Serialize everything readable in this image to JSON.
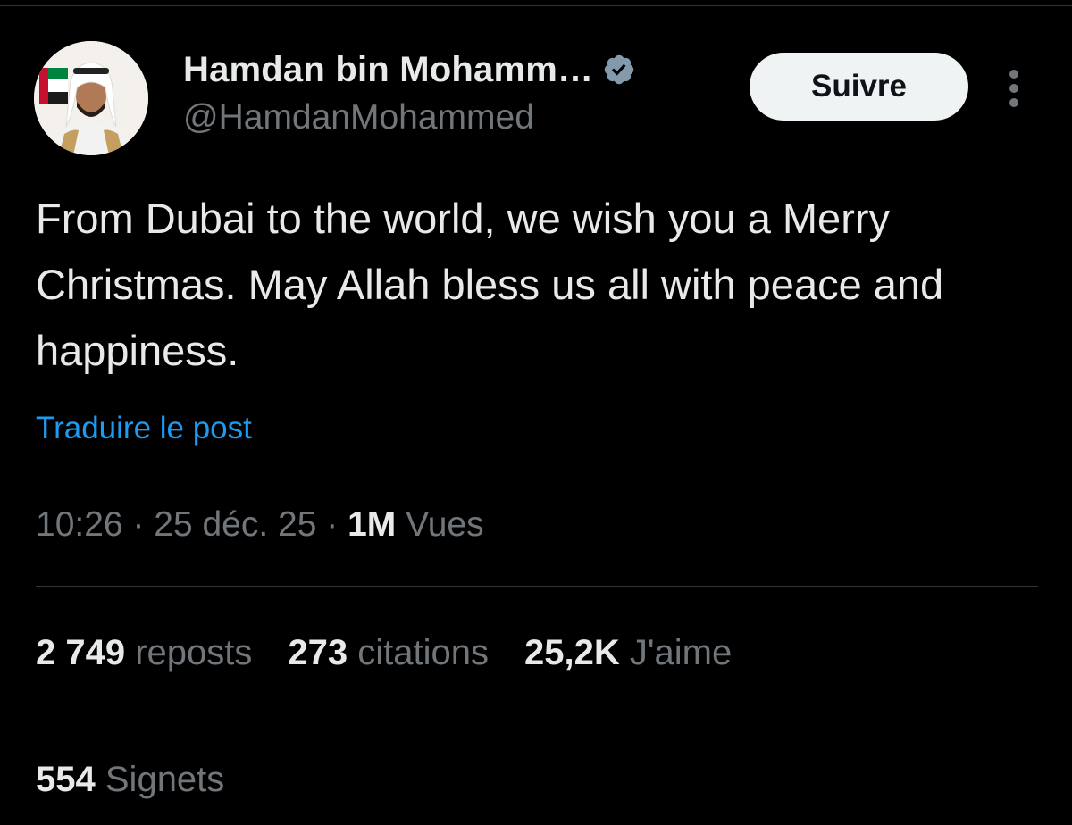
{
  "author": {
    "display_name": "Hamdan bin Mohamm…",
    "handle": "@HamdanMohammed",
    "verified_icon": "verified-badge-icon",
    "avatar_icon": "profile-photo"
  },
  "header": {
    "follow_label": "Suivre",
    "more_icon": "more-vertical-icon"
  },
  "post": {
    "text": "From Dubai to the world, we wish you a Merry Christmas. May Allah bless us all with peace and happiness.",
    "translate_label": "Traduire le post"
  },
  "meta": {
    "time": "10:26",
    "separator": " · ",
    "date": "25 déc. 25",
    "views_count": "1M",
    "views_label": "Vues"
  },
  "stats": {
    "reposts_count": "2 749",
    "reposts_label": "reposts",
    "quotes_count": "273",
    "quotes_label": "citations",
    "likes_count": "25,2K",
    "likes_label": "J'aime",
    "bookmarks_count": "554",
    "bookmarks_label": "Signets"
  },
  "colors": {
    "background": "#000000",
    "text_primary": "#e7e9ea",
    "text_secondary": "#71767b",
    "link": "#1d9bf0",
    "divider": "#2f3336",
    "follow_button_bg": "#eff3f4",
    "verified_badge": "#829aab"
  }
}
